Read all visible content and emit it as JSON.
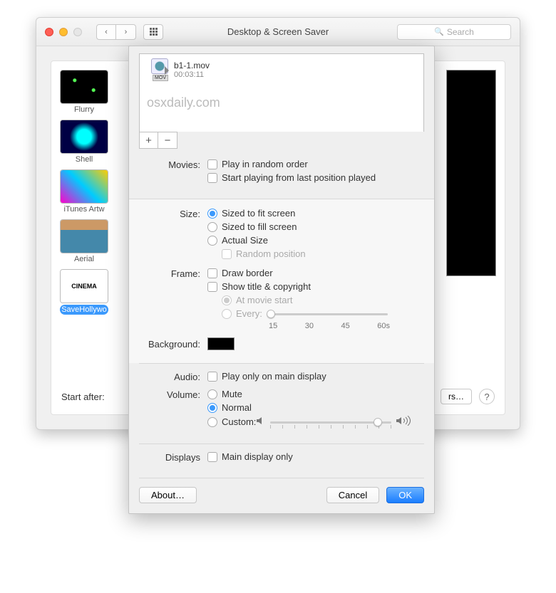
{
  "window": {
    "title": "Desktop & Screen Saver",
    "search_placeholder": "Search",
    "thumbs": [
      {
        "label": "Flurry"
      },
      {
        "label": "Shell"
      },
      {
        "label": "iTunes Artw"
      },
      {
        "label": "Aerial"
      },
      {
        "label": "SaveHollywo",
        "selected": true
      }
    ],
    "start_after_label": "Start after:",
    "rs_button": "rs…",
    "help": "?"
  },
  "sheet": {
    "file": {
      "name": "b1-1.mov",
      "duration": "00:03:11"
    },
    "watermark": "osxdaily.com",
    "add_glyph": "+",
    "remove_glyph": "−",
    "movies": {
      "label": "Movies:",
      "random": "Play in random order",
      "resume": "Start playing from last position played"
    },
    "size": {
      "label": "Size:",
      "fit": "Sized to fit screen",
      "fill": "Sized to fill screen",
      "actual": "Actual Size",
      "random_pos": "Random position"
    },
    "frame": {
      "label": "Frame:",
      "border": "Draw border",
      "title": "Show title & copyright",
      "at_start": "At movie start",
      "every": "Every:",
      "ticks": {
        "t1": "15",
        "t2": "30",
        "t3": "45",
        "t4": "60s"
      }
    },
    "background": {
      "label": "Background:",
      "color": "#000000"
    },
    "audio": {
      "label": "Audio:",
      "main": "Play only on main display"
    },
    "volume": {
      "label": "Volume:",
      "mute": "Mute",
      "normal": "Normal",
      "custom": "Custom:"
    },
    "displays": {
      "label": "Displays",
      "main": "Main display only"
    },
    "buttons": {
      "about": "About…",
      "cancel": "Cancel",
      "ok": "OK"
    }
  }
}
